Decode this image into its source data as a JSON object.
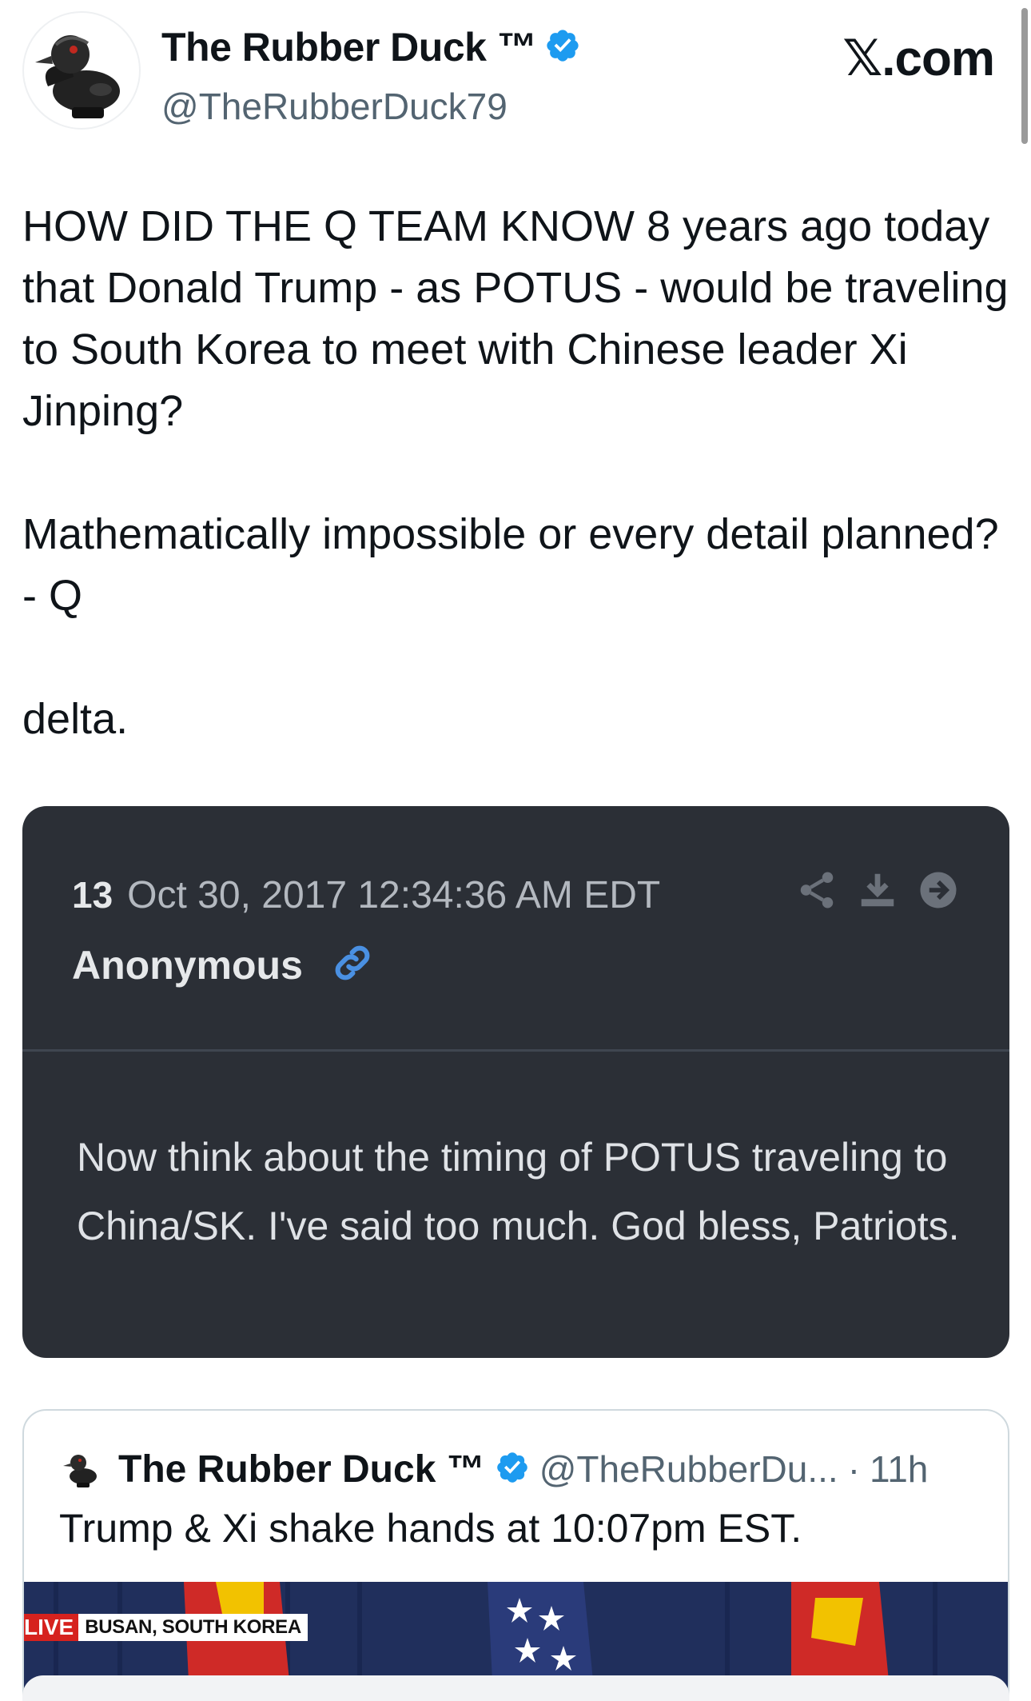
{
  "header": {
    "display_name": "The Rubber Duck ™",
    "handle": "@TheRubberDuck79",
    "site": "𝕏.com"
  },
  "tweet": {
    "paragraph1": "HOW DID THE Q TEAM KNOW 8 years ago today that Donald Trump - as POTUS - would be traveling to South Korea to meet with Chinese leader Xi Jinping?",
    "paragraph2": "Mathematically impossible or every detail planned? - Q",
    "paragraph3": "delta."
  },
  "q_card": {
    "number": "13",
    "date": "Oct 30, 2017 12:34:36 AM EDT",
    "author": "Anonymous",
    "body": "Now think about the timing of POTUS traveling to China/SK. I've said too much. God bless, Patriots.",
    "icons": [
      "share-icon",
      "download-icon",
      "arrow-right-circle-icon",
      "link-icon"
    ]
  },
  "quoted_tweet": {
    "display_name": "The Rubber Duck ™",
    "handle": "@TheRubberDu...",
    "separator": "·",
    "time": "11h",
    "text": "Trump & Xi shake hands at 10:07pm EST.",
    "media": {
      "live_label": "LIVE",
      "location_label": "BUSAN, SOUTH KOREA"
    }
  },
  "colors": {
    "verified": "#1d9bf0",
    "card_bg": "#2b2f36",
    "link_icon": "#4a90e2",
    "live_red": "#d6221e"
  }
}
